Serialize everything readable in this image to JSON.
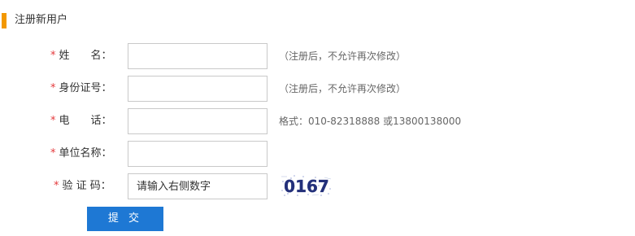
{
  "section": {
    "title": "注册新用户",
    "accent_color": "#f39800"
  },
  "form": {
    "required_mark": "*",
    "required_color": "#e4393c",
    "name": {
      "label": "姓　　名：",
      "value": "",
      "hint": "（注册后，不允许再次修改）"
    },
    "id_number": {
      "label": "身份证号：",
      "value": "",
      "hint": "（注册后，不允许再次修改）"
    },
    "phone": {
      "label": "电　　话：",
      "value": "",
      "hint": "格式：010-82318888 或13800138000"
    },
    "company": {
      "label": "单位名称：",
      "value": ""
    },
    "captcha": {
      "label": "验 证 码：",
      "value": "",
      "placeholder": "请输入右侧数字",
      "image_text": "0167"
    },
    "submit_label": "提 交",
    "submit_color": "#1e78d4"
  }
}
